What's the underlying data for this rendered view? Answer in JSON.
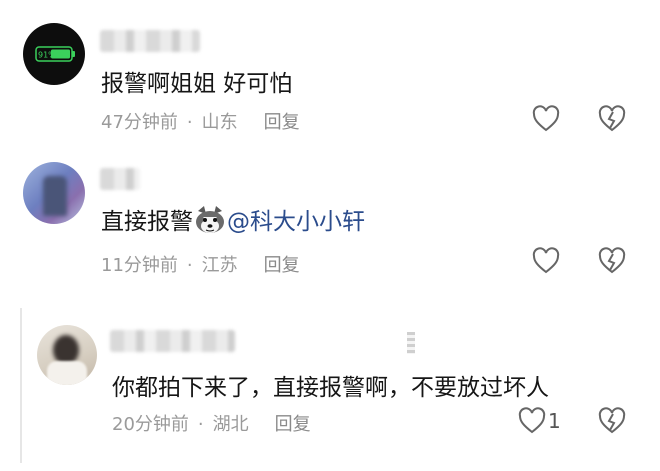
{
  "comments": [
    {
      "text": "报警啊姐姐  好可怕",
      "time": "47分钟前",
      "location": "山东",
      "reply_label": "回复",
      "battery_text": "91%"
    },
    {
      "text_before": "直接报警",
      "emoji_icon": "husky-face-icon",
      "mention": "@科大小小轩",
      "time": "11分钟前",
      "location": "江苏",
      "reply_label": "回复"
    },
    {
      "text": "你都拍下来了，直接报警啊，不要放过坏人",
      "time": "20分钟前",
      "location": "湖北",
      "reply_label": "回复",
      "like_count": "1"
    }
  ],
  "separator": "·",
  "colors": {
    "mention": "#2b4c8c",
    "meta": "#9a9a9a",
    "battery_green": "#3bd15c"
  }
}
